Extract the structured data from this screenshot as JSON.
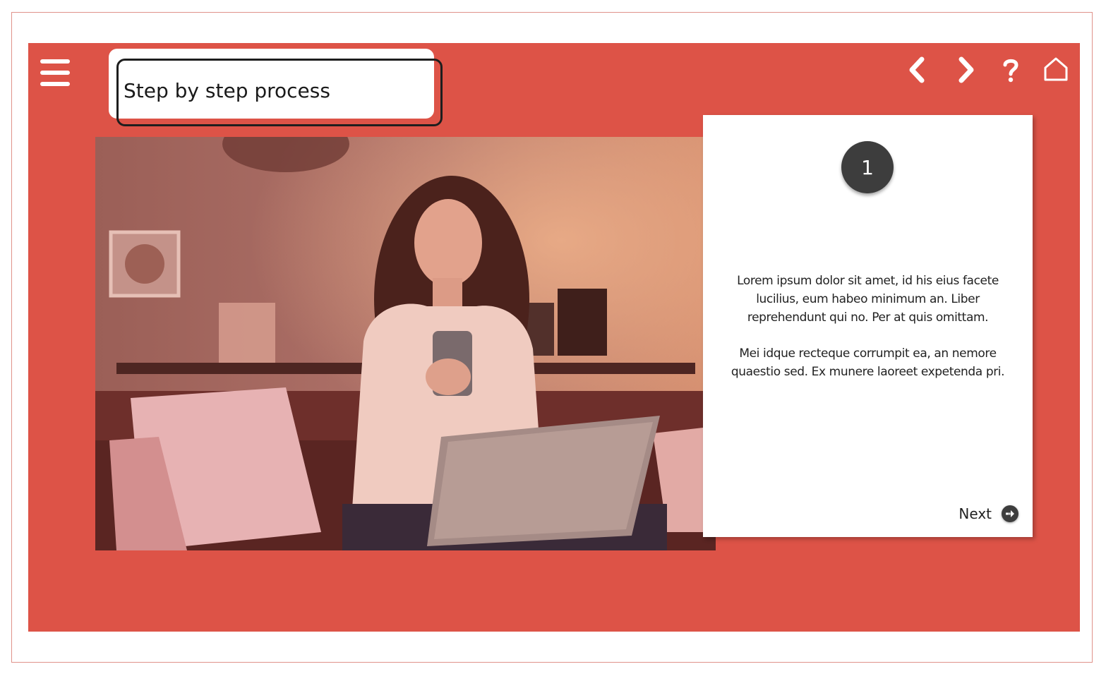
{
  "header": {
    "title": "Step by step process",
    "menu_icon": "hamburger-menu-icon",
    "nav": {
      "prev_icon": "chevron-left-icon",
      "next_icon": "chevron-right-icon",
      "help_icon": "question-mark-icon",
      "home_icon": "home-icon"
    }
  },
  "media": {
    "image_icon": "photo-woman-with-phone-and-laptop"
  },
  "step_card": {
    "step_number": "1",
    "paragraphs": [
      "Lorem ipsum dolor sit amet, id his eius facete lucilius, eum habeo minimum an. Liber reprehendunt qui no. Per at quis omittam.",
      "Mei idque recteque corrumpit ea, an nemore quaestio sed. Ex munere laoreet expetenda pri."
    ],
    "next_label": "Next",
    "next_icon": "arrow-right-circle-icon"
  },
  "colors": {
    "stage": "#dd5347",
    "card": "#ffffff",
    "badge": "#3d3d3d"
  }
}
